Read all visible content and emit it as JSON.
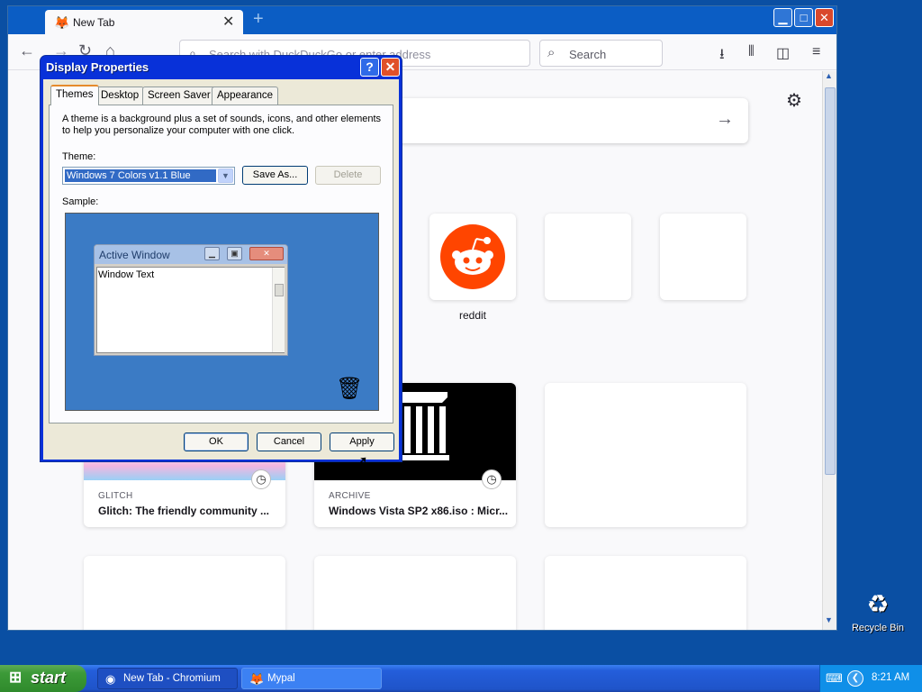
{
  "browser": {
    "tab_title": "New Tab",
    "new_tab_symbol": "+",
    "tab_close_symbol": "✕",
    "window_buttons": {
      "minimize": "▁",
      "maximize": "□",
      "close": "✕"
    },
    "url_placeholder": "Search with DuckDuckGo or enter address",
    "search_placeholder": "Search",
    "toolbar_icons": [
      "download-icon",
      "library-icon",
      "sidebar-icon",
      "menu-icon"
    ]
  },
  "newtab": {
    "top_sites": [
      {
        "label": "reddit"
      }
    ],
    "highlights": [
      {
        "source": "GLITCH",
        "title": "Glitch: The friendly community ..."
      },
      {
        "source": "ARCHIVE",
        "title": "Windows Vista SP2 x86.iso : Micr..."
      }
    ]
  },
  "dialog": {
    "title": "Display Properties",
    "help_symbol": "?",
    "close_symbol": "✕",
    "tabs": [
      {
        "label": "Themes",
        "active": true
      },
      {
        "label": "Desktop",
        "active": false
      },
      {
        "label": "Screen Saver",
        "active": false
      },
      {
        "label": "Appearance",
        "active": false
      }
    ],
    "description": "A theme is a background plus a set of sounds, icons, and other elements to help you personalize your computer with one click.",
    "theme_label": "Theme:",
    "theme_value": "Windows 7 Colors v1.1 Blue",
    "save_as_label": "Save As...",
    "delete_label": "Delete",
    "sample_label": "Sample:",
    "sample": {
      "window_title": "Active Window",
      "window_text": "Window Text"
    },
    "ok_label": "OK",
    "cancel_label": "Cancel",
    "apply_label": "Apply"
  },
  "desktop": {
    "recycle_bin_label": "Recycle Bin"
  },
  "taskbar": {
    "start_label": "start",
    "items": [
      {
        "label": "New Tab - Chromium",
        "active": true
      },
      {
        "label": "Mypal",
        "active": false
      }
    ],
    "clock": "8:21 AM"
  },
  "colors": {
    "desktop": "#0a4fa3",
    "xp_title_blue": "#0831d9",
    "reddit": "#ff4500",
    "active_tab_accent": "#e68b2c"
  }
}
